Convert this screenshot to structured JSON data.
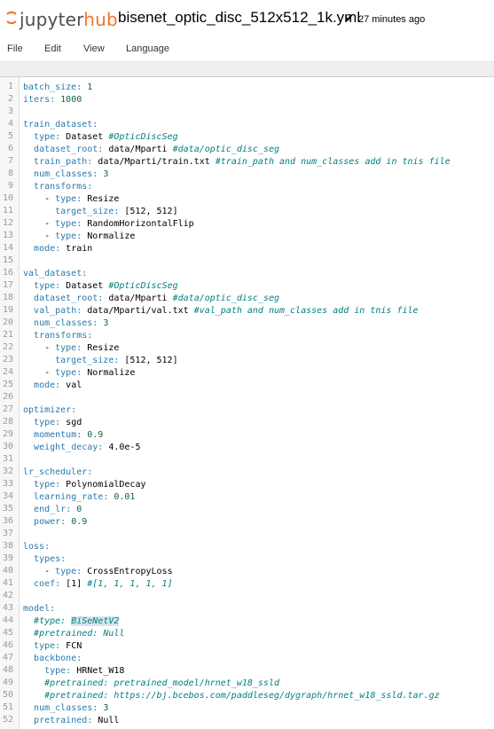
{
  "header": {
    "logo_text_a": "jupyter",
    "logo_text_b": "hub",
    "file_name": "bisenet_optic_disc_512x512_1k.yml",
    "save_status": "27 minutes ago",
    "colors": {
      "brand_orange": "#f37726",
      "brand_gray": "#4e4e4e"
    }
  },
  "menu": {
    "items": [
      "File",
      "Edit",
      "View",
      "Language"
    ]
  },
  "editor": {
    "lines": [
      [
        [
          "key",
          "batch_size:"
        ],
        [
          "t",
          " "
        ],
        [
          "num",
          "1"
        ]
      ],
      [
        [
          "key",
          "iters:"
        ],
        [
          "t",
          " "
        ],
        [
          "num",
          "1000"
        ]
      ],
      [],
      [
        [
          "key",
          "train_dataset:"
        ]
      ],
      [
        [
          "t",
          "  "
        ],
        [
          "key",
          "type:"
        ],
        [
          "t",
          " Dataset "
        ],
        [
          "cm",
          "#OpticDiscSeg"
        ]
      ],
      [
        [
          "t",
          "  "
        ],
        [
          "key",
          "dataset_root:"
        ],
        [
          "t",
          " data/Mparti "
        ],
        [
          "cm",
          "#data/optic_disc_seg"
        ]
      ],
      [
        [
          "t",
          "  "
        ],
        [
          "key",
          "train_path:"
        ],
        [
          "t",
          " data/Mparti/train.txt "
        ],
        [
          "cm",
          "#train_path and num_classes add in tnis file"
        ]
      ],
      [
        [
          "t",
          "  "
        ],
        [
          "key",
          "num_classes:"
        ],
        [
          "t",
          " "
        ],
        [
          "num",
          "3"
        ]
      ],
      [
        [
          "t",
          "  "
        ],
        [
          "key",
          "transforms:"
        ]
      ],
      [
        [
          "t",
          "    - "
        ],
        [
          "key",
          "type:"
        ],
        [
          "t",
          " Resize"
        ]
      ],
      [
        [
          "t",
          "      "
        ],
        [
          "key",
          "target_size:"
        ],
        [
          "t",
          " [512, 512]"
        ]
      ],
      [
        [
          "t",
          "    - "
        ],
        [
          "key",
          "type:"
        ],
        [
          "t",
          " RandomHorizontalFlip"
        ]
      ],
      [
        [
          "t",
          "    - "
        ],
        [
          "key",
          "type:"
        ],
        [
          "t",
          " Normalize"
        ]
      ],
      [
        [
          "t",
          "  "
        ],
        [
          "key",
          "mode:"
        ],
        [
          "t",
          " train"
        ]
      ],
      [],
      [
        [
          "key",
          "val_dataset:"
        ]
      ],
      [
        [
          "t",
          "  "
        ],
        [
          "key",
          "type:"
        ],
        [
          "t",
          " Dataset "
        ],
        [
          "cm",
          "#OpticDiscSeg"
        ]
      ],
      [
        [
          "t",
          "  "
        ],
        [
          "key",
          "dataset_root:"
        ],
        [
          "t",
          " data/Mparti "
        ],
        [
          "cm",
          "#data/optic_disc_seg"
        ]
      ],
      [
        [
          "t",
          "  "
        ],
        [
          "key",
          "val_path:"
        ],
        [
          "t",
          " data/Mparti/val.txt "
        ],
        [
          "cm",
          "#val_path and num_classes add in tnis file"
        ]
      ],
      [
        [
          "t",
          "  "
        ],
        [
          "key",
          "num_classes:"
        ],
        [
          "t",
          " "
        ],
        [
          "num",
          "3"
        ]
      ],
      [
        [
          "t",
          "  "
        ],
        [
          "key",
          "transforms:"
        ]
      ],
      [
        [
          "t",
          "    - "
        ],
        [
          "key",
          "type:"
        ],
        [
          "t",
          " Resize"
        ]
      ],
      [
        [
          "t",
          "      "
        ],
        [
          "key",
          "target_size:"
        ],
        [
          "t",
          " [512, 512]"
        ]
      ],
      [
        [
          "t",
          "    - "
        ],
        [
          "key",
          "type:"
        ],
        [
          "t",
          " Normalize"
        ]
      ],
      [
        [
          "t",
          "  "
        ],
        [
          "key",
          "mode:"
        ],
        [
          "t",
          " val"
        ]
      ],
      [],
      [
        [
          "key",
          "optimizer:"
        ]
      ],
      [
        [
          "t",
          "  "
        ],
        [
          "key",
          "type:"
        ],
        [
          "t",
          " sgd"
        ]
      ],
      [
        [
          "t",
          "  "
        ],
        [
          "key",
          "momentum:"
        ],
        [
          "t",
          " "
        ],
        [
          "num",
          "0.9"
        ]
      ],
      [
        [
          "t",
          "  "
        ],
        [
          "key",
          "weight_decay:"
        ],
        [
          "t",
          " 4.0e-5"
        ]
      ],
      [],
      [
        [
          "key",
          "lr_scheduler:"
        ]
      ],
      [
        [
          "t",
          "  "
        ],
        [
          "key",
          "type:"
        ],
        [
          "t",
          " PolynomialDecay"
        ]
      ],
      [
        [
          "t",
          "  "
        ],
        [
          "key",
          "learning_rate:"
        ],
        [
          "t",
          " "
        ],
        [
          "num",
          "0.01"
        ]
      ],
      [
        [
          "t",
          "  "
        ],
        [
          "key",
          "end_lr:"
        ],
        [
          "t",
          " "
        ],
        [
          "num",
          "0"
        ]
      ],
      [
        [
          "t",
          "  "
        ],
        [
          "key",
          "power:"
        ],
        [
          "t",
          " "
        ],
        [
          "num",
          "0.9"
        ]
      ],
      [],
      [
        [
          "key",
          "loss:"
        ]
      ],
      [
        [
          "t",
          "  "
        ],
        [
          "key",
          "types:"
        ]
      ],
      [
        [
          "t",
          "    - "
        ],
        [
          "key",
          "type:"
        ],
        [
          "t",
          " CrossEntropyLoss"
        ]
      ],
      [
        [
          "t",
          "  "
        ],
        [
          "key",
          "coef:"
        ],
        [
          "t",
          " [1] "
        ],
        [
          "cm",
          "#[1, 1, 1, 1, 1]"
        ]
      ],
      [],
      [
        [
          "key",
          "model:"
        ]
      ],
      [
        [
          "t",
          "  "
        ],
        [
          "cm",
          "#type: "
        ],
        [
          "cmhl",
          "BiSeNetV2"
        ]
      ],
      [
        [
          "t",
          "  "
        ],
        [
          "cm",
          "#pretrained: Null"
        ]
      ],
      [
        [
          "t",
          "  "
        ],
        [
          "key",
          "type:"
        ],
        [
          "t",
          " FCN"
        ]
      ],
      [
        [
          "t",
          "  "
        ],
        [
          "key",
          "backbone:"
        ]
      ],
      [
        [
          "t",
          "    "
        ],
        [
          "key",
          "type:"
        ],
        [
          "t",
          " HRNet_W18"
        ]
      ],
      [
        [
          "t",
          "    "
        ],
        [
          "cm",
          "#pretrained: pretrained_model/hrnet_w18_ssld"
        ]
      ],
      [
        [
          "t",
          "    "
        ],
        [
          "cm",
          "#pretrained: https://bj.bcebos.com/paddleseg/dygraph/hrnet_w18_ssld.tar.gz"
        ]
      ],
      [
        [
          "t",
          "  "
        ],
        [
          "key",
          "num_classes:"
        ],
        [
          "t",
          " "
        ],
        [
          "num",
          "3"
        ]
      ],
      [
        [
          "t",
          "  "
        ],
        [
          "key",
          "pretrained:"
        ],
        [
          "t",
          " Null"
        ]
      ]
    ]
  }
}
